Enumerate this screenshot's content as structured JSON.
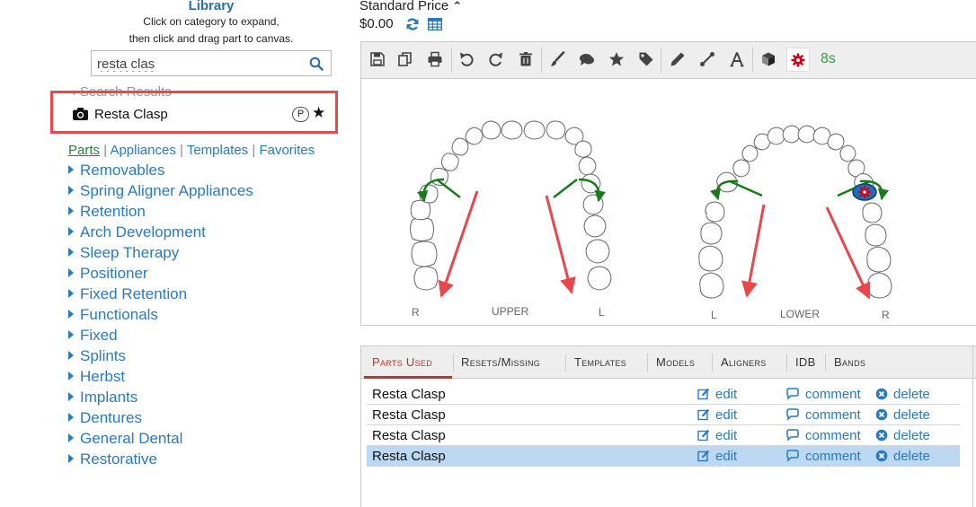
{
  "library": {
    "title": "Library",
    "subtitle_line1": "Click on category to expand,",
    "subtitle_line2": "then click and drag part to canvas.",
    "search_value": "resta clas",
    "search_results_label": "Search Results",
    "result": {
      "label": "Resta Clasp",
      "badge": "P"
    },
    "links": [
      "Parts",
      "Appliances",
      "Templates",
      "Favorites"
    ],
    "link_separator": "|",
    "categories": [
      "Removables",
      "Spring Aligner Appliances",
      "Retention",
      "Arch Development",
      "Sleep Therapy",
      "Positioner",
      "Fixed Retention",
      "Functionals",
      "Fixed",
      "Splints",
      "Herbst",
      "Implants",
      "Dentures",
      "General Dental",
      "Restorative"
    ]
  },
  "price": {
    "label": "Standard Price",
    "value": "$0.00"
  },
  "toolbar": {
    "timer": "8s"
  },
  "canvas": {
    "upper": {
      "label": "UPPER",
      "left": "R",
      "right": "L"
    },
    "lower": {
      "label": "LOWER",
      "left": "L",
      "right": "R"
    }
  },
  "tabs": [
    "Parts Used",
    "Resets/Missing",
    "Templates",
    "Models",
    "Aligners",
    "IDB",
    "Bands"
  ],
  "parts": [
    {
      "name": "Resta Clasp",
      "edit": "edit",
      "comment": "comment",
      "delete": "delete"
    },
    {
      "name": "Resta Clasp",
      "edit": "edit",
      "comment": "comment",
      "delete": "delete"
    },
    {
      "name": "Resta Clasp",
      "edit": "edit",
      "comment": "comment",
      "delete": "delete"
    },
    {
      "name": "Resta Clasp",
      "edit": "edit",
      "comment": "comment",
      "delete": "delete"
    }
  ],
  "colors": {
    "link": "#2a7bbd",
    "active_tab": "#c9302c",
    "selected_row": "#bcd8f3",
    "highlight_box": "#e8474c",
    "timer": "#2ea043"
  }
}
